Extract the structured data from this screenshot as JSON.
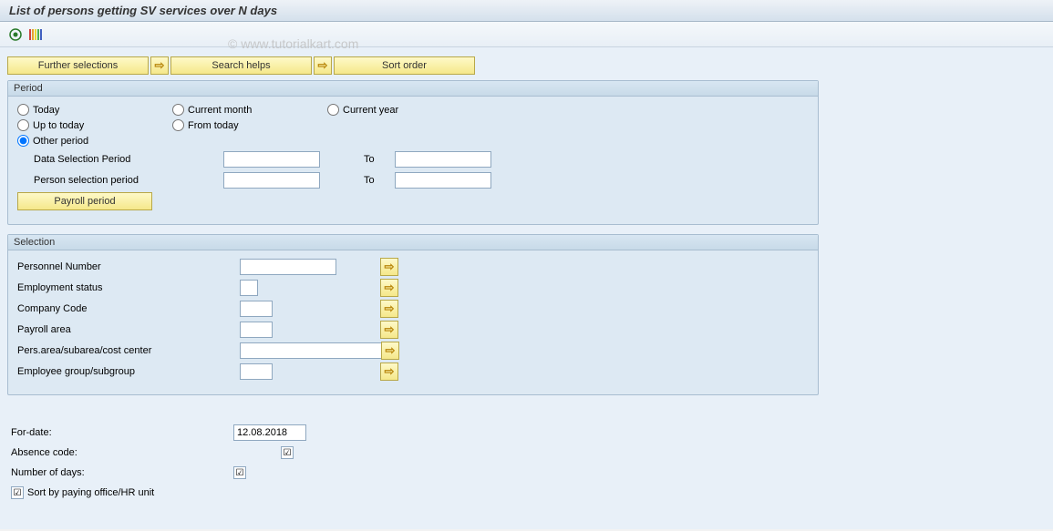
{
  "title": "List of persons getting SV services over N days",
  "watermark": "© www.tutorialkart.com",
  "toolbar_buttons": {
    "further_selections": "Further selections",
    "search_helps": "Search helps",
    "sort_order": "Sort order"
  },
  "period": {
    "group_title": "Period",
    "today": "Today",
    "current_month": "Current month",
    "current_year": "Current year",
    "up_to_today": "Up to today",
    "from_today": "From today",
    "other_period": "Other period",
    "data_selection_period": "Data Selection Period",
    "person_selection_period": "Person selection period",
    "to": "To",
    "payroll_period_btn": "Payroll period",
    "selected_radio": "other_period",
    "data_from": "",
    "data_to": "",
    "person_from": "",
    "person_to": ""
  },
  "selection": {
    "group_title": "Selection",
    "personnel_number": "Personnel Number",
    "employment_status": "Employment status",
    "company_code": "Company Code",
    "payroll_area": "Payroll area",
    "pers_area": "Pers.area/subarea/cost center",
    "employee_group": "Employee group/subgroup",
    "values": {
      "personnel_number": "",
      "employment_status": "",
      "company_code": "",
      "payroll_area": "",
      "pers_area": "",
      "employee_group": ""
    }
  },
  "bottom": {
    "for_date": "For-date:",
    "for_date_value": "12.08.2018",
    "absence_code": "Absence code:",
    "absence_checked": true,
    "number_of_days": "Number of days:",
    "number_checked": true,
    "sort_by": "Sort by paying office/HR unit",
    "sort_checked": true
  }
}
